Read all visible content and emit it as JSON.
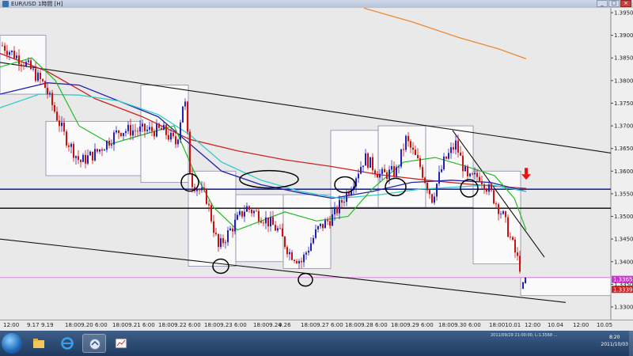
{
  "window": {
    "title": "EUR/USD 1時間 [H]",
    "buttons": {
      "minimize": "_",
      "maximize": "□",
      "close": "×"
    }
  },
  "chart": {
    "symbol": "EUR/USD",
    "y_ticks": [
      "1.3950",
      "1.3900",
      "1.3850",
      "1.3800",
      "1.3750",
      "1.3700",
      "1.3650",
      "1.3600",
      "1.3550",
      "1.3500",
      "1.3450",
      "1.3400",
      "1.3350",
      "1.3300"
    ],
    "price_labels": {
      "current_high": "1.3365",
      "current_low": "1.3339"
    },
    "x_ticks": [
      "12:00",
      "9.17",
      "9.19",
      "18:009.20 6:00",
      "18:009.21 6:00",
      "18:009.22 6:00",
      "18:009.23 6:00",
      "18:009.24",
      "9.26",
      "18:009.27 6:00",
      "18:009.28 6:00",
      "18:009.29 6:00",
      "18:009.30 6:00",
      "18:0010.01",
      "12:00",
      "10.04",
      "12:00",
      "10.05"
    ],
    "colors": {
      "background": "#e9e9e9",
      "up_candle": "#2222bb",
      "down_candle": "#cc1111",
      "ma_fast": "#22bb22",
      "ma_mid": "#2222aa",
      "ma_slow": "#cc2222",
      "ma_cyan": "#33cccc",
      "ma_orange": "#ee8833",
      "support_blue": "#1a2aa8",
      "support_black": "#000000",
      "pink_line": "#dd88dd",
      "arrow": "#ee1111"
    }
  },
  "taskbar": {
    "tray_text": "2011/09/29 21:00:00, L:1.3568 ...",
    "clock_time": "8:20",
    "clock_date": "2011/10/03"
  }
}
